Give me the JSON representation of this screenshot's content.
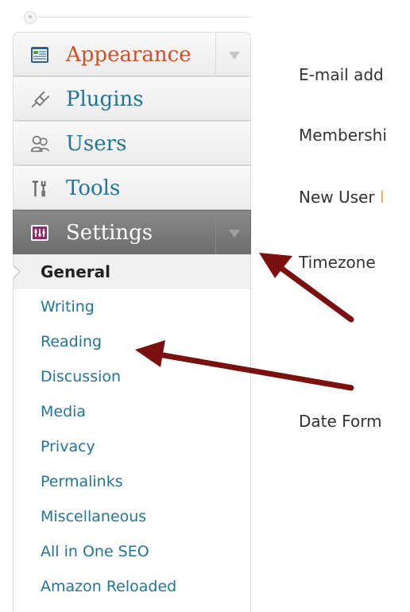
{
  "collapse": {
    "glyph": "«"
  },
  "menu": {
    "items": [
      {
        "label": "Appearance",
        "icon": "appearance-icon"
      },
      {
        "label": "Plugins",
        "icon": "plugins-icon"
      },
      {
        "label": "Users",
        "icon": "users-icon"
      },
      {
        "label": "Tools",
        "icon": "tools-icon"
      },
      {
        "label": "Settings",
        "icon": "settings-icon"
      }
    ],
    "settings_submenu": [
      "General",
      "Writing",
      "Reading",
      "Discussion",
      "Media",
      "Privacy",
      "Permalinks",
      "Miscellaneous",
      "All in One SEO",
      "Amazon Reloaded"
    ],
    "current_submenu_item": "General"
  },
  "content": {
    "labels": {
      "email": "E-mail add",
      "membership": "Membershi",
      "new_user": "New User ",
      "new_user_tail": "l",
      "timezone": "Timezone",
      "date_format": "Date Form"
    }
  },
  "colors": {
    "link": "#21759b",
    "hover": "#d54e21",
    "settings_bg": "#777777",
    "arrow": "#7a1010"
  }
}
